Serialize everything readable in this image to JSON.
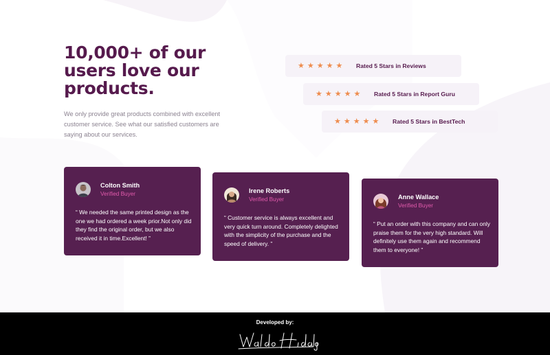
{
  "hero": {
    "headline": "10,000+ of our users love our products.",
    "intro": "We only provide great products combined with excellent customer service. See what our satisfied customers are saying about our services."
  },
  "ratings": [
    {
      "stars": 5,
      "label": "Rated 5 Stars in Reviews"
    },
    {
      "stars": 5,
      "label": "Rated 5 Stars in Report Guru"
    },
    {
      "stars": 5,
      "label": "Rated 5 Stars in BestTech"
    }
  ],
  "star_glyph": "★",
  "testimonials": [
    {
      "name": "Colton Smith",
      "status": "Verified Buyer",
      "quote": "“ We needed the same printed design as the one we had ordered a week prior.Not only did they find the original order, but we also received it in time.Excellent! ”"
    },
    {
      "name": "Irene Roberts",
      "status": "Verified Buyer",
      "quote": "“ Customer service is always excellent and very quick turn around. Completely delighted with the simplicity of the purchase and the speed of delivery. ”"
    },
    {
      "name": "Anne Wallace",
      "status": "Verified Buyer",
      "quote": "“ Put an order with this company and can only praise them for the very high standard. Will definitely use them again and recommend them to everyone! ”"
    }
  ],
  "footer": {
    "label": "Developed by:",
    "signature": "Waldo Hidalgo"
  },
  "colors": {
    "primary": "#561a4d",
    "card": "#562050",
    "accent_pink": "#e25aac",
    "star": "#ee8c4e",
    "rating_bg": "#f6f2f8"
  },
  "icons": [
    "star-icon",
    "avatar-colton",
    "avatar-irene",
    "avatar-anne"
  ]
}
